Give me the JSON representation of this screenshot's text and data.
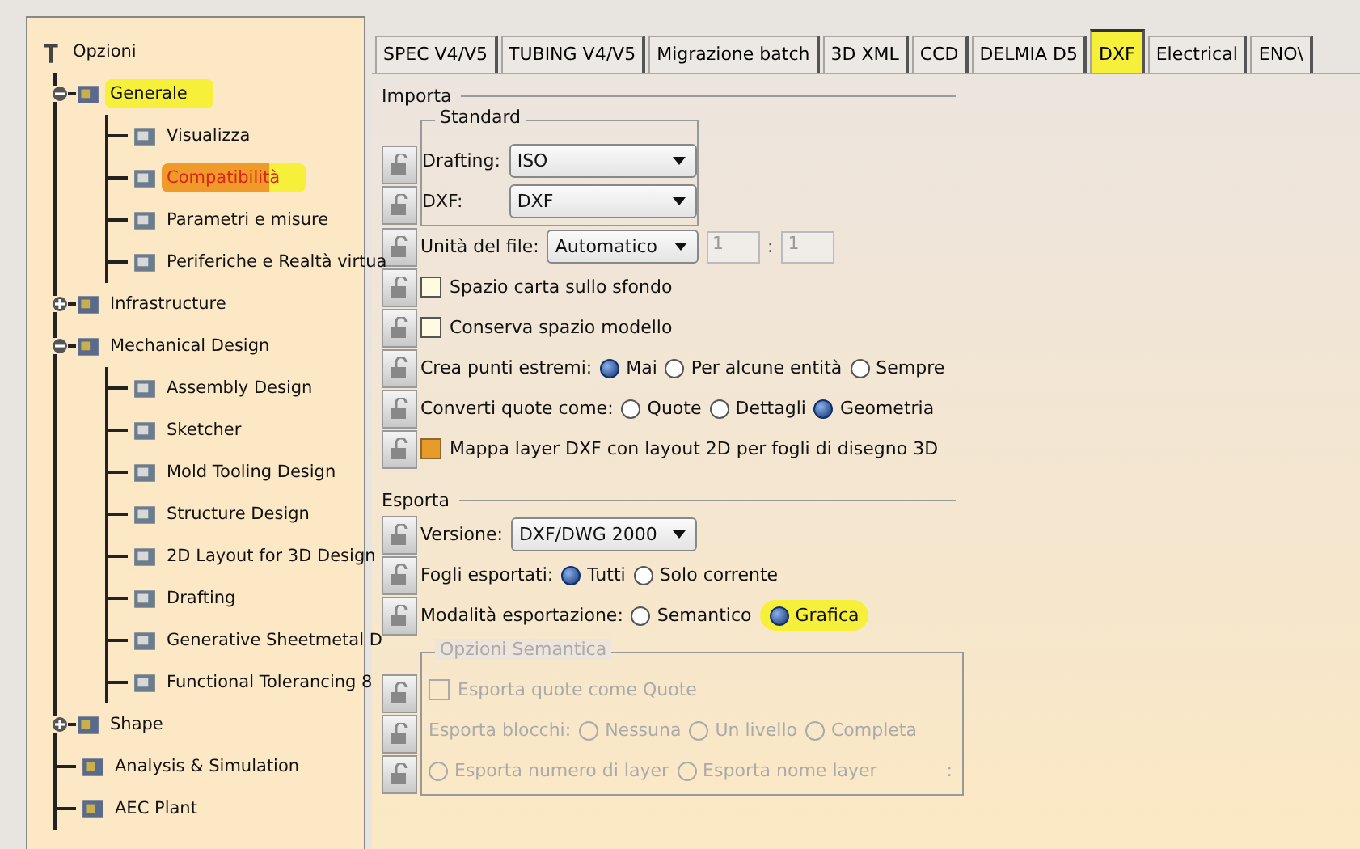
{
  "tree": {
    "label": "Opzioni",
    "children": [
      {
        "label": "Generale",
        "expanded": true,
        "selected": false,
        "highlighted": true,
        "children": [
          {
            "label": "Visualizza",
            "selected": false,
            "highlighted": false
          },
          {
            "label": "Compatibilità",
            "selected": true,
            "highlighted": true
          },
          {
            "label": "Parametri e misure",
            "selected": false,
            "highlighted": false
          },
          {
            "label": "Periferiche e Realtà virtua",
            "selected": false,
            "highlighted": false
          }
        ]
      },
      {
        "label": "Infrastructure",
        "expanded": false,
        "selected": false,
        "highlighted": false
      },
      {
        "label": "Mechanical Design",
        "expanded": true,
        "selected": false,
        "highlighted": false,
        "children": [
          {
            "label": "Assembly Design",
            "selected": false,
            "highlighted": false
          },
          {
            "label": "Sketcher",
            "selected": false,
            "highlighted": false
          },
          {
            "label": "Mold Tooling Design",
            "selected": false,
            "highlighted": false
          },
          {
            "label": "Structure Design",
            "selected": false,
            "highlighted": false
          },
          {
            "label": "2D Layout for 3D Design",
            "selected": false,
            "highlighted": false
          },
          {
            "label": "Drafting",
            "selected": false,
            "highlighted": false
          },
          {
            "label": "Generative Sheetmetal D",
            "selected": false,
            "highlighted": false
          },
          {
            "label": "Functional Tolerancing 8",
            "selected": false,
            "highlighted": false
          }
        ]
      },
      {
        "label": "Shape",
        "expanded": false,
        "selected": false,
        "highlighted": false
      },
      {
        "label": "Analysis & Simulation",
        "selected": false,
        "highlighted": false
      },
      {
        "label": "AEC Plant",
        "selected": false,
        "highlighted": false
      }
    ]
  },
  "tabs": [
    {
      "label": "SPEC V4/V5",
      "selected": false,
      "highlighted": false
    },
    {
      "label": "TUBING V4/V5",
      "selected": false,
      "highlighted": false
    },
    {
      "label": "Migrazione batch",
      "selected": false,
      "highlighted": false
    },
    {
      "label": "3D XML",
      "selected": false,
      "highlighted": false
    },
    {
      "label": "CCD",
      "selected": false,
      "highlighted": false
    },
    {
      "label": "DELMIA D5",
      "selected": false,
      "highlighted": false
    },
    {
      "label": "DXF",
      "selected": true,
      "highlighted": true
    },
    {
      "label": "Electrical",
      "selected": false,
      "highlighted": false
    },
    {
      "label": "ENO\\",
      "selected": false,
      "highlighted": false
    }
  ],
  "import": {
    "title": "Importa",
    "standard": {
      "title": "Standard",
      "fields": [
        {
          "label": "Drafting:",
          "value": "ISO"
        },
        {
          "label": "DXF:",
          "value": "DXF"
        }
      ]
    },
    "rows": [
      {
        "kind": "unit",
        "label": "Unità del file:",
        "value": "Automatico",
        "ratio": [
          "1",
          "1"
        ],
        "separator": ":"
      },
      {
        "kind": "checkbox",
        "label": "Spazio carta sullo sfondo",
        "checked": false
      },
      {
        "kind": "checkbox",
        "label": "Conserva spazio modello",
        "checked": false
      },
      {
        "kind": "radio",
        "label": "Crea punti estremi:",
        "options": [
          {
            "label": "Mai",
            "selected": true,
            "highlighted": false
          },
          {
            "label": "Per alcune entità",
            "selected": false,
            "highlighted": false
          },
          {
            "label": "Sempre",
            "selected": false,
            "highlighted": false
          }
        ]
      },
      {
        "kind": "radio",
        "label": "Converti quote come:",
        "options": [
          {
            "label": "Quote",
            "selected": false,
            "highlighted": false
          },
          {
            "label": "Dettagli",
            "selected": false,
            "highlighted": false
          },
          {
            "label": "Geometria",
            "selected": true,
            "highlighted": false
          }
        ]
      },
      {
        "kind": "checkbox",
        "label": "Mappa layer DXF con layout 2D per fogli di disegno 3D",
        "checked": true
      }
    ]
  },
  "export": {
    "title": "Esporta",
    "rows": [
      {
        "kind": "combo",
        "label": "Versione:",
        "value": "DXF/DWG 2000"
      },
      {
        "kind": "radio",
        "label": "Fogli esportati:",
        "options": [
          {
            "label": "Tutti",
            "selected": true,
            "highlighted": false
          },
          {
            "label": "Solo corrente",
            "selected": false,
            "highlighted": false
          }
        ]
      },
      {
        "kind": "radio",
        "label": "Modalità esportazione:",
        "options": [
          {
            "label": "Semantico",
            "selected": false,
            "highlighted": false
          },
          {
            "label": "Grafica",
            "selected": true,
            "highlighted": true
          }
        ]
      }
    ],
    "semantic": {
      "title": "Opzioni Semantica",
      "disabled": true,
      "rows": [
        {
          "kind": "checkbox",
          "label": "Esporta quote come Quote",
          "checked": false
        },
        {
          "kind": "radio",
          "label": "Esporta blocchi:",
          "options": [
            {
              "label": "Nessuna",
              "selected": false,
              "highlighted": false
            },
            {
              "label": "Un livello",
              "selected": false,
              "highlighted": false
            },
            {
              "label": "Completa",
              "selected": false,
              "highlighted": false
            }
          ]
        },
        {
          "kind": "radio",
          "suffix": ":",
          "options": [
            {
              "label": "Esporta numero di layer",
              "selected": false,
              "highlighted": false
            },
            {
              "label": "Esporta nome layer",
              "selected": false,
              "highlighted": false
            }
          ]
        }
      ]
    }
  }
}
